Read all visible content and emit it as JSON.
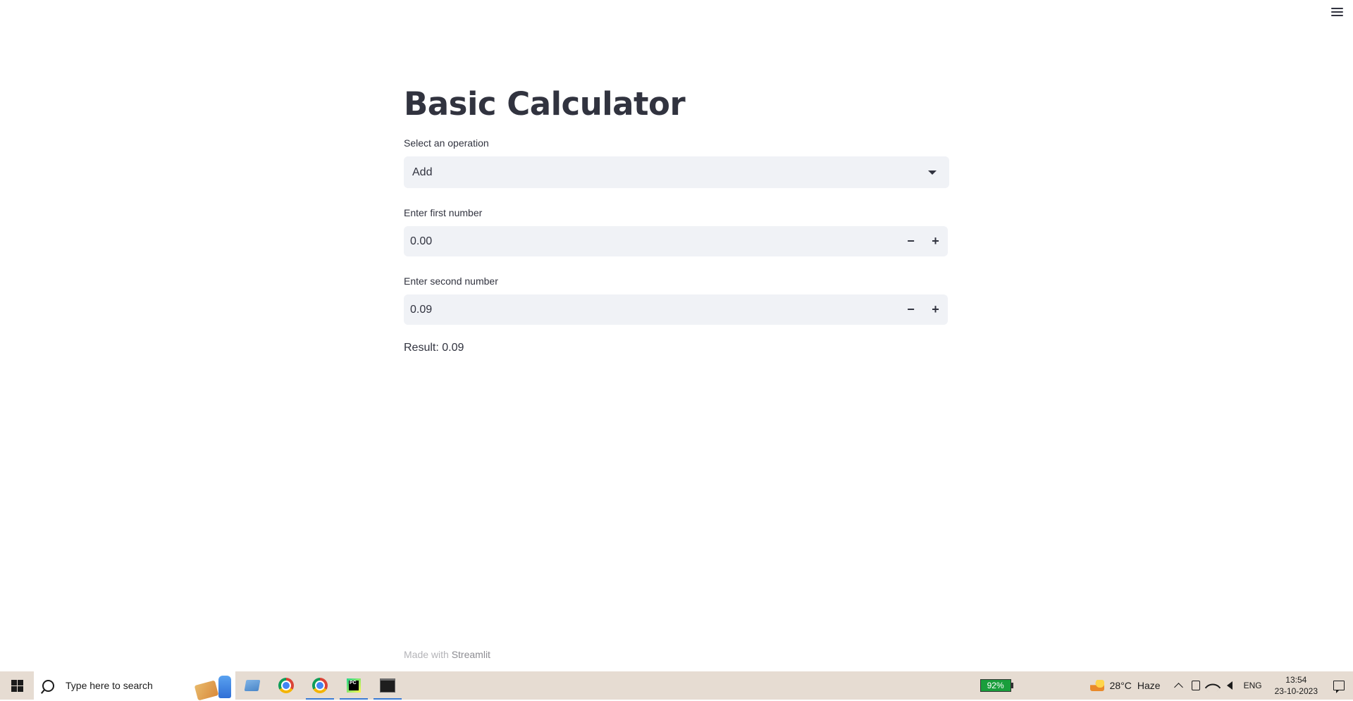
{
  "app": {
    "title": "Basic Calculator",
    "operation_label": "Select an operation",
    "operation_value": "Add",
    "first_label": "Enter first number",
    "first_value": "0.00",
    "second_label": "Enter second number",
    "second_value": "0.09",
    "minus_symbol": "−",
    "plus_symbol": "+",
    "result_text": "Result: 0.09",
    "footer_prefix": "Made with ",
    "footer_link": "Streamlit"
  },
  "taskbar": {
    "search_placeholder": "Type here to search",
    "pycharm_glyph": "PC",
    "battery_percent": "92%",
    "weather_temp": "28°C",
    "weather_desc": "Haze",
    "language": "ENG",
    "time": "13:54",
    "date": "23-10-2023"
  },
  "icons": {
    "menu": "hamburger-menu-icon",
    "dropdown": "chevron-down-icon",
    "windows": "windows-logo-icon",
    "search": "search-icon",
    "files": "file-explorer-icon",
    "chrome": "chrome-icon",
    "pycharm": "pycharm-icon",
    "terminal": "terminal-icon",
    "weather": "weather-icon",
    "notifications": "notification-icon"
  },
  "colors": {
    "input_bg": "#f0f2f6",
    "text": "#31333f",
    "taskbar_bg": "#e6dcd2",
    "battery_green": "#1a9e3c"
  }
}
